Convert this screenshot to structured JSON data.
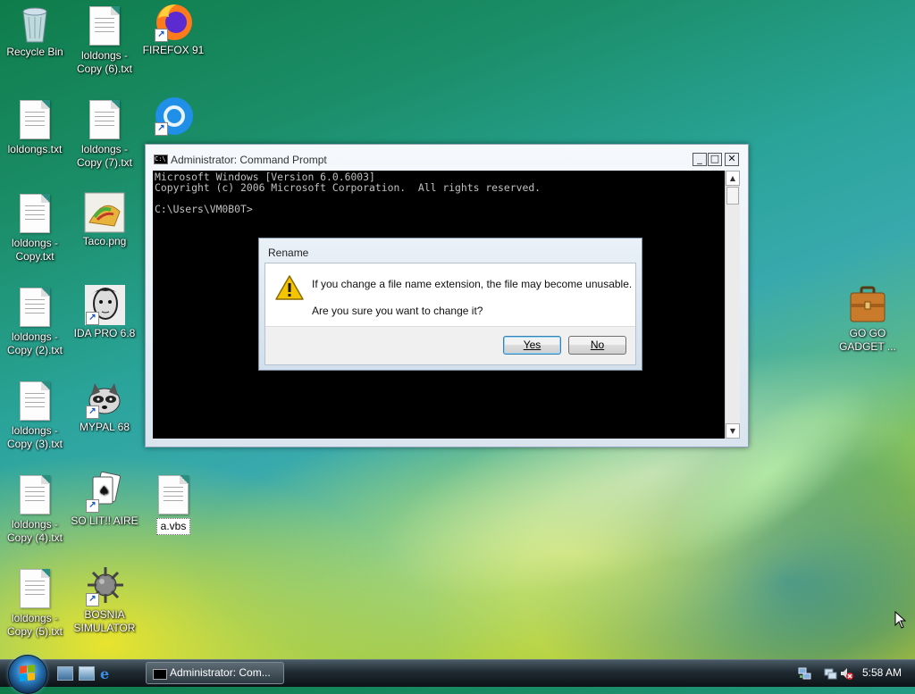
{
  "desktop": {
    "icons": {
      "recycle_bin": "Recycle Bin",
      "copy6": "loldongs - Copy (6).txt",
      "firefox": "FIREFOX 91",
      "loldongs": "loldongs.txt",
      "copy7": "loldongs - Copy (7).txt",
      "copy": "loldongs - Copy.txt",
      "taco": "Taco.png",
      "copy2": "loldongs - Copy (2).txt",
      "ida": "IDA PRO 6.8",
      "copy3": "loldongs - Copy (3).txt",
      "mypal": "MYPAL 68",
      "copy4": "loldongs - Copy (4).txt",
      "solitaire": "SO LIT!! AIRE",
      "avbs": "a.vbs",
      "copy5": "loldongs - Copy (5).txt",
      "bosnia": "BOSNIA SIMULATOR",
      "gadget": "GO GO GADGET ..."
    }
  },
  "cmd_window": {
    "title": "Administrator: Command Prompt",
    "icon_text": "C:\\",
    "controls": {
      "minimize": "_",
      "maximize": "□",
      "close": "✕"
    },
    "console_text": "Microsoft Windows [Version 6.0.6003]\nCopyright (c) 2006 Microsoft Corporation.  All rights reserved.\n\nC:\\Users\\VM0B0T>"
  },
  "dialog": {
    "title": "Rename",
    "message_line1": "If you change a file name extension, the file may become unusable.",
    "message_line2": "Are you sure you want to change it?",
    "yes_label": "Yes",
    "no_label": "No"
  },
  "taskbar": {
    "task_label": "Administrator: Com...",
    "clock": "5:58 AM"
  },
  "colors": {
    "console_bg": "#000000",
    "console_text": "#c0c0c0",
    "warning_yellow": "#f5c400"
  },
  "icon_names": [
    "recycle-bin-icon",
    "text-file-icon",
    "firefox-icon",
    "chrome-icon",
    "taco-image-icon",
    "ida-pro-icon",
    "mypal-raccoon-icon",
    "solitaire-cards-icon",
    "vbs-file-icon",
    "spiked-mine-icon",
    "briefcase-icon",
    "warning-icon",
    "start-orb-icon",
    "show-desktop-icon",
    "switch-windows-icon",
    "internet-explorer-icon",
    "network-icon",
    "volume-muted-icon",
    "mouse-cursor-icon"
  ]
}
